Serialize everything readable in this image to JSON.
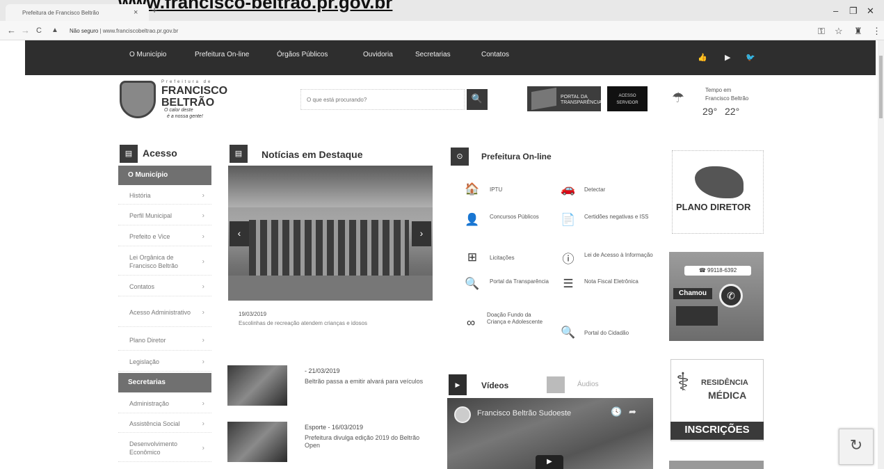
{
  "browser": {
    "top_partial_url": "www.francisco-beltrao.pr.gov.br",
    "tab_title": "Prefeitura de Francisco Beltrão",
    "tab_close": "×",
    "new_tab": "+",
    "win_min": "–",
    "win_max": "❐",
    "win_close": "✕",
    "back": "←",
    "forward": "→",
    "reload": "C",
    "warn": "▲",
    "not_secure": "Não seguro",
    "url": "www.franciscobeltrao.pr.gov.br",
    "key_icon": "⚿",
    "star_icon": "☆",
    "ext_icon": "♜",
    "menu_icon": "⋮"
  },
  "nav": {
    "items": [
      "O Município",
      "Prefeitura On-line",
      "Órgãos Públicos",
      "Ouvidoria",
      "Secretarias",
      "Contatos"
    ],
    "icons": [
      "👍",
      "▶",
      "🐦"
    ]
  },
  "header": {
    "pref_small": "Prefeitura de",
    "name_line1": "FRANCISCO",
    "name_line2": "BELTRÃO",
    "tagline1": "O calor deste",
    "tagline2": "é a nossa gente!",
    "search_placeholder": "O que está procurando?",
    "search_icon": "🔍",
    "portal_line1": "PORTAL DA",
    "portal_line2": "TRANSPARÊNCIA",
    "servidor_line1": "ACESSO",
    "servidor_line2": "SERVIDOR",
    "weather_line1": "Tempo em",
    "weather_line2": "Francisco Beltrão",
    "temp_max": "29°",
    "temp_min": "22°",
    "weather_icon": "☂"
  },
  "menu": {
    "title": "Acesso",
    "icon": "▤",
    "sections": [
      {
        "head": "O Município"
      },
      {
        "head": "Secretarias"
      }
    ],
    "items_municipio": [
      "História",
      "Perfil Municipal",
      "Prefeito e Vice",
      "Lei Orgânica de Francisco Beltrão",
      "Contatos",
      "Acesso Administrativo",
      "Plano Diretor",
      "Legislação"
    ],
    "items_secretarias": [
      "Administração",
      "Assistência Social",
      "Desenvolvimento Econômico"
    ],
    "chev": "›"
  },
  "news": {
    "title": "Notícias em Destaque",
    "icon": "▤",
    "prev": "‹",
    "next": "›",
    "featured_date": "19/03/2019",
    "featured_caption": "Escolinhas de recreação atendem crianças e idosos",
    "items": [
      {
        "date": "- 21/03/2019",
        "text": "Beltrão passa a emitir alvará para veículos"
      },
      {
        "date": "Esporte - 16/03/2019",
        "text": "Prefeitura divulga edição 2019 do Beltrão Open"
      }
    ]
  },
  "online": {
    "title": "Prefeitura On-line",
    "icon": "⊙",
    "services": [
      {
        "icon": "🏠",
        "label": "IPTU"
      },
      {
        "icon": "🚗",
        "label": "Detectar"
      },
      {
        "icon": "👤",
        "label": "Concursos Públicos"
      },
      {
        "icon": "📄",
        "label": "Certidões negativas e ISS"
      },
      {
        "icon": "⊞",
        "label": "Licitações"
      },
      {
        "icon": "ⓘ",
        "label": "Lei de Acesso à Informação"
      },
      {
        "icon": "🔍",
        "label": "Portal da Transparência"
      },
      {
        "icon": "☰",
        "label": "Nota Fiscal Eletrônica"
      },
      {
        "icon": "∞",
        "label": "Doação Fundo da Criança e Adolescente"
      },
      {
        "icon": "🔍",
        "label": "Portal do Cidadão"
      }
    ]
  },
  "media": {
    "videos_label": "Vídeos",
    "videos_icon": "▶",
    "audios_label": "Áudios",
    "video_title": "Francisco Beltrão Sudoeste",
    "clock_icon": "🕓",
    "share_icon": "➦",
    "play_icon": "▶"
  },
  "banners": {
    "plano": "PLANO DIRETOR",
    "chamou_phone": "☎ 99118-6392",
    "chamou_label": "Chamou",
    "chamou_wa": "✆",
    "res_line1": "RESIDÊNCIA",
    "res_line2": "MÉDICA",
    "res_btn": "INSCRIÇÕES",
    "res_icon": "⚕"
  },
  "recaptcha_icon": "↻"
}
